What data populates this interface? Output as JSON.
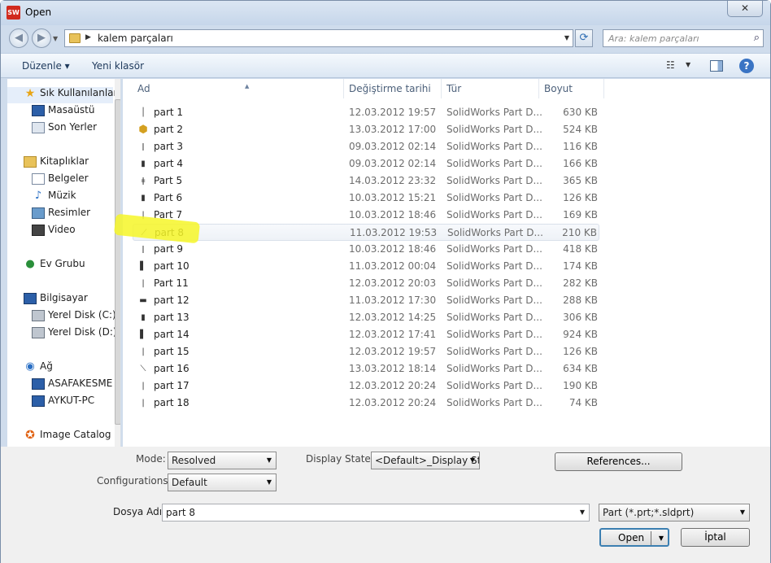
{
  "window": {
    "title": "Open",
    "app_icon": "SW",
    "close": "✕"
  },
  "address": {
    "path": "kalem parçaları",
    "search_placeholder": "Ara: kalem parçaları"
  },
  "toolbar": {
    "organize": "Düzenle ▾",
    "new_folder": "Yeni klasör"
  },
  "nav": [
    {
      "label": "Sık Kullanılanlar",
      "icon": "star-icon"
    },
    {
      "label": "Masaüstü",
      "icon": "desktop-icon"
    },
    {
      "label": "Son Yerler",
      "icon": "recent-places-icon"
    },
    {
      "label": "Kitaplıklar",
      "icon": "library-icon"
    },
    {
      "label": "Belgeler",
      "icon": "documents-icon"
    },
    {
      "label": "Müzik",
      "icon": "music-icon"
    },
    {
      "label": "Resimler",
      "icon": "pictures-icon"
    },
    {
      "label": "Video",
      "icon": "video-icon"
    },
    {
      "label": "Ev Grubu",
      "icon": "homegroup-icon"
    },
    {
      "label": "Bilgisayar",
      "icon": "computer-icon"
    },
    {
      "label": "Yerel Disk (C:)",
      "icon": "drive-icon"
    },
    {
      "label": "Yerel Disk (D:)",
      "icon": "drive-icon"
    },
    {
      "label": "Ağ",
      "icon": "network-icon"
    },
    {
      "label": "ASAFAKESME",
      "icon": "pc-icon"
    },
    {
      "label": "AYKUT-PC",
      "icon": "pc-icon"
    },
    {
      "label": "Image Catalog",
      "icon": "image-catalog-icon"
    }
  ],
  "columns": {
    "name": "Ad",
    "date": "Değiştirme tarihi",
    "type": "Tür",
    "size": "Boyut"
  },
  "files": [
    {
      "name": "part 1",
      "date": "12.03.2012 19:57",
      "type": "SolidWorks Part D...",
      "size": "630 KB"
    },
    {
      "name": "part 2",
      "date": "13.03.2012 17:00",
      "type": "SolidWorks Part D...",
      "size": "524 KB"
    },
    {
      "name": "part 3",
      "date": "09.03.2012 02:14",
      "type": "SolidWorks Part D...",
      "size": "116 KB"
    },
    {
      "name": "part 4",
      "date": "09.03.2012 02:14",
      "type": "SolidWorks Part D...",
      "size": "166 KB"
    },
    {
      "name": "Part 5",
      "date": "14.03.2012 23:32",
      "type": "SolidWorks Part D...",
      "size": "365 KB"
    },
    {
      "name": "Part 6",
      "date": "10.03.2012 15:21",
      "type": "SolidWorks Part D...",
      "size": "126 KB"
    },
    {
      "name": "Part 7",
      "date": "10.03.2012 18:46",
      "type": "SolidWorks Part D...",
      "size": "169 KB"
    },
    {
      "name": "part 8",
      "date": "11.03.2012 19:53",
      "type": "SolidWorks Part D...",
      "size": "210 KB"
    },
    {
      "name": "part 9",
      "date": "10.03.2012 18:46",
      "type": "SolidWorks Part D...",
      "size": "418 KB"
    },
    {
      "name": "part 10",
      "date": "11.03.2012 00:04",
      "type": "SolidWorks Part D...",
      "size": "174 KB"
    },
    {
      "name": "Part 11",
      "date": "12.03.2012 20:03",
      "type": "SolidWorks Part D...",
      "size": "282 KB"
    },
    {
      "name": "part 12",
      "date": "11.03.2012 17:30",
      "type": "SolidWorks Part D...",
      "size": "288 KB"
    },
    {
      "name": "part 13",
      "date": "12.03.2012 14:25",
      "type": "SolidWorks Part D...",
      "size": "306 KB"
    },
    {
      "name": "part 14",
      "date": "12.03.2012 17:41",
      "type": "SolidWorks Part D...",
      "size": "924 KB"
    },
    {
      "name": "part 15",
      "date": "12.03.2012 19:57",
      "type": "SolidWorks Part D...",
      "size": "126 KB"
    },
    {
      "name": "part 16",
      "date": "13.03.2012 18:14",
      "type": "SolidWorks Part D...",
      "size": "634 KB"
    },
    {
      "name": "part 17",
      "date": "12.03.2012 20:24",
      "type": "SolidWorks Part D...",
      "size": "190 KB"
    },
    {
      "name": "part 18",
      "date": "12.03.2012 20:24",
      "type": "SolidWorks Part D...",
      "size": "74 KB"
    }
  ],
  "options": {
    "mode_label": "Mode:",
    "mode_value": "Resolved",
    "display_states_label": "Display States:",
    "display_states_value": "<Default>_Display St",
    "configurations_label": "Configurations:",
    "configurations_value": "Default",
    "references": "References..."
  },
  "bottom": {
    "filename_label": "Dosya Adı:",
    "filename_value": "part 8",
    "filetype": "Part (*.prt;*.sldprt)",
    "open": "Open",
    "cancel": "İptal"
  },
  "colors": {
    "highlight": "#f6f628",
    "accent": "#3a74c4"
  }
}
